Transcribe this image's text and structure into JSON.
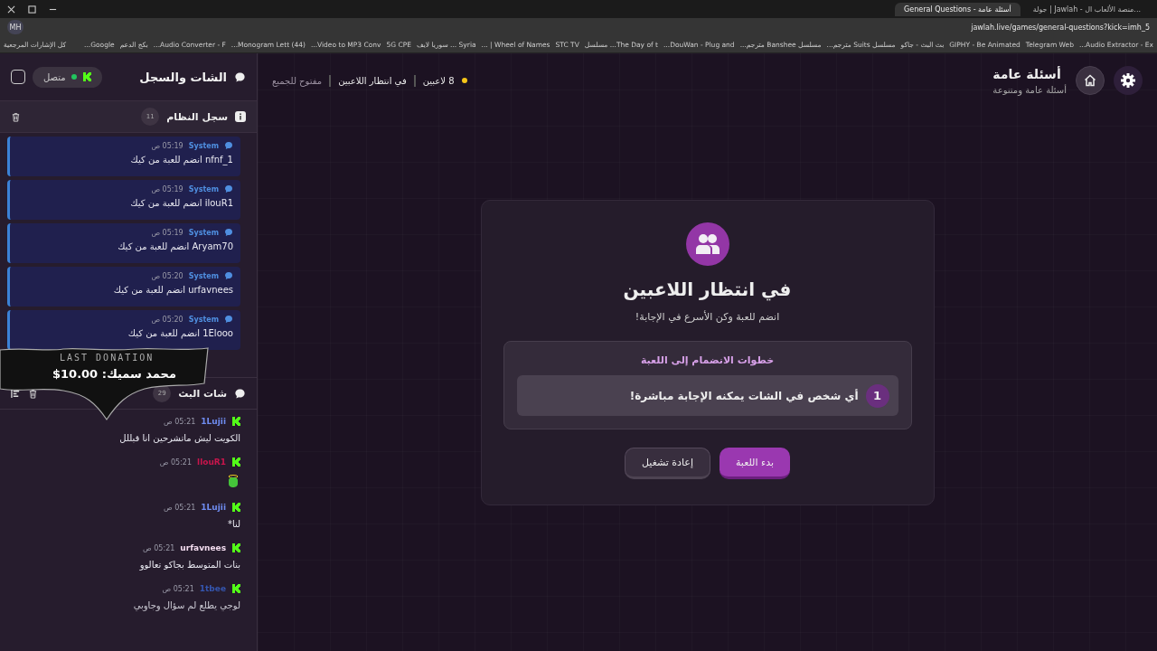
{
  "browser": {
    "tabs": [
      {
        "title": "جولة | Jawlah - منصة الألعاب ال...",
        "selected": false
      },
      {
        "title": "General Questions - أسئلة عامة",
        "selected": true
      }
    ],
    "profile": "MH",
    "url": "jawlah.live/games/general-questions?kick=imh_5",
    "all_bookmarks": "كل الإشارات المرجعية",
    "bookmarks": [
      "Audio Extractor - Ex...",
      "Telegram Web",
      "GIPHY - Be Animated",
      "بث البث - جاكو",
      "مسلسل Suits مترجم...",
      "مسلسل Banshee مترجم...",
      "DouWan - Plug and...",
      "The Day of t... مسلسل",
      "STC TV",
      "Wheel of Names | ...",
      "Syria ... سوريا لايف",
      "5G CPE",
      "Video to MP3 Conv...",
      "(44) Monogram Lett...",
      "Audio Converter - F...",
      "بكج الدعم",
      "Google..."
    ]
  },
  "sidebar": {
    "title": "الشات والسجل",
    "status": "متصل",
    "connected": true,
    "system_log": {
      "title": "سجل النظام",
      "count": "11",
      "messages": [
        {
          "sender": "System",
          "time": "05:19 ص",
          "text": "nfnf_1 انضم للعبة من كيك"
        },
        {
          "sender": "System",
          "time": "05:19 ص",
          "text": "ilouR1 انضم للعبة من كيك"
        },
        {
          "sender": "System",
          "time": "05:19 ص",
          "text": "Aryam70 انضم للعبة من كيك"
        },
        {
          "sender": "System",
          "time": "05:20 ص",
          "text": "urfavnees انضم للعبة من كيك"
        },
        {
          "sender": "System",
          "time": "05:20 ص",
          "text": "1Elooo انضم للعبة من كيك"
        }
      ]
    },
    "stream_chat": {
      "title": "شات البث",
      "count": "29",
      "messages": [
        {
          "user": "1Lujii",
          "color": "#6f8cf0",
          "time": "05:21 ص",
          "kind": "text",
          "text": "الكويت ليش ماتشرحين انا قبللل"
        },
        {
          "user": "llouR1",
          "color": "#c8154c",
          "time": "05:21 ص",
          "kind": "emote"
        },
        {
          "user": "1Lujii",
          "color": "#6f8cf0",
          "time": "05:21 ص",
          "kind": "text",
          "text": "لنا*"
        },
        {
          "user": "urfavnees",
          "color": "#f3dcef",
          "time": "05:21 ص",
          "kind": "text",
          "text": "بنات المتوسط بجاكو تعالوو"
        },
        {
          "user": "1tbee",
          "color": "#3556b0",
          "time": "05:21 ص",
          "kind": "text",
          "text": "لوجي يطلع لم سؤال وجاوبي"
        }
      ]
    }
  },
  "header": {
    "title": "أسئلة عامة",
    "subtitle": "أسئلة عامة ومتنوعة",
    "players": "8 لاعبين",
    "state": "في انتظار اللاعبين",
    "access": "مفتوح للجميع"
  },
  "card": {
    "title": "في انتظار اللاعبين",
    "subtitle": "انضم للعبة وكن الأسرع في الإجابة!",
    "steps_title": "خطوات الانضمام إلى اللعبة",
    "steps": [
      {
        "number": "1",
        "text": "أي شخص في الشات يمكنه الإجابة مباشرة!"
      }
    ],
    "buttons": [
      {
        "label": "بدء اللعبة",
        "kind": "primary"
      },
      {
        "label": "إعادة تشغيل",
        "kind": "secondary"
      }
    ]
  },
  "donation": {
    "label": "LAST DONATION",
    "text": "محمد سميك: 10.00$"
  }
}
